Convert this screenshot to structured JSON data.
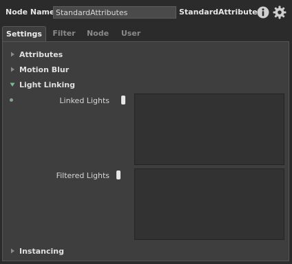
{
  "header": {
    "node_name_label": "Node Name",
    "node_name_value": "StandardAttributes",
    "node_type": "StandardAttributes",
    "icons": [
      "info-icon",
      "gear-icon"
    ]
  },
  "tabs": [
    {
      "label": "Settings",
      "active": true
    },
    {
      "label": "Filter",
      "active": false
    },
    {
      "label": "Node",
      "active": false
    },
    {
      "label": "User",
      "active": false
    }
  ],
  "sections": {
    "attributes": {
      "label": "Attributes",
      "expanded": false
    },
    "motion_blur": {
      "label": "Motion Blur",
      "expanded": false
    },
    "light_linking": {
      "label": "Light Linking",
      "expanded": true
    },
    "instancing": {
      "label": "Instancing",
      "expanded": false
    }
  },
  "light_linking": {
    "linked_lights_label": "Linked Lights",
    "filtered_lights_label": "Filtered Lights"
  },
  "colors": {
    "background": "#2b2b2b",
    "panel": "#3e3e3e",
    "expanded_arrow": "#6fc38a",
    "collapsed_arrow": "#8c8c8c"
  }
}
